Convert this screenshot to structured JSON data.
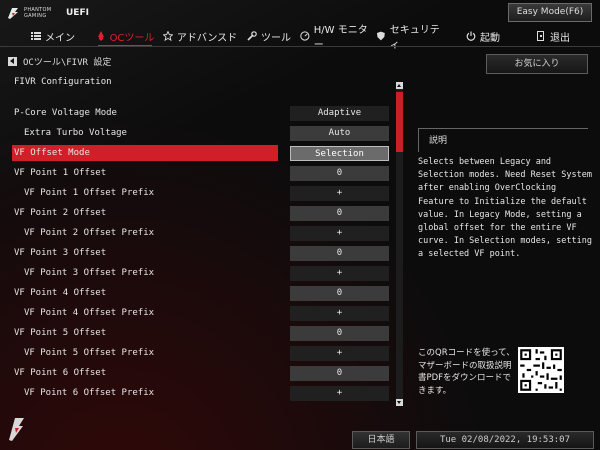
{
  "header": {
    "brand_line1": "PHANTOM",
    "brand_line2": "GAMING",
    "brand_uefi": "UEFI",
    "easy_mode": "Easy Mode(F6)"
  },
  "nav": [
    {
      "label": "メイン",
      "icon": "list-icon"
    },
    {
      "label": "OCツール",
      "icon": "rocket-icon",
      "active": true
    },
    {
      "label": "アドバンスド",
      "icon": "star-icon"
    },
    {
      "label": "ツール",
      "icon": "wrench-icon"
    },
    {
      "label": "H/W モニター",
      "icon": "monitor-icon"
    },
    {
      "label": "セキュリティ",
      "icon": "shield-icon"
    },
    {
      "label": "起動",
      "icon": "power-icon"
    },
    {
      "label": "退出",
      "icon": "exit-icon"
    }
  ],
  "breadcrumb": "OCツール\\FIVR 設定",
  "section_title": "FIVR Configuration",
  "favorite": "お気に入り",
  "rows": [
    {
      "label": "P-Core Voltage Mode",
      "indent": 0,
      "value": "Adaptive",
      "style": "dark"
    },
    {
      "label": "Extra Turbo Voltage",
      "indent": 1,
      "value": "Auto",
      "style": "light"
    },
    {
      "label": "VF Offset Mode",
      "indent": 0,
      "value": "Selection",
      "style": "sel",
      "highlight": true
    },
    {
      "label": "VF Point 1 Offset",
      "indent": 0,
      "value": "0",
      "style": "light"
    },
    {
      "label": "VF Point 1 Offset Prefix",
      "indent": 2,
      "value": "+",
      "style": "dark"
    },
    {
      "label": "VF Point 2 Offset",
      "indent": 0,
      "value": "0",
      "style": "light"
    },
    {
      "label": "VF Point 2 Offset Prefix",
      "indent": 2,
      "value": "+",
      "style": "dark"
    },
    {
      "label": "VF Point 3 Offset",
      "indent": 0,
      "value": "0",
      "style": "light"
    },
    {
      "label": "VF Point 3 Offset Prefix",
      "indent": 2,
      "value": "+",
      "style": "dark"
    },
    {
      "label": "VF Point 4 Offset",
      "indent": 0,
      "value": "0",
      "style": "light"
    },
    {
      "label": "VF Point 4 Offset Prefix",
      "indent": 2,
      "value": "+",
      "style": "dark"
    },
    {
      "label": "VF Point 5 Offset",
      "indent": 0,
      "value": "0",
      "style": "light"
    },
    {
      "label": "VF Point 5 Offset Prefix",
      "indent": 2,
      "value": "+",
      "style": "dark"
    },
    {
      "label": "VF Point 6 Offset",
      "indent": 0,
      "value": "0",
      "style": "light"
    },
    {
      "label": "VF Point 6 Offset Prefix",
      "indent": 2,
      "value": "+",
      "style": "dark"
    }
  ],
  "help": {
    "title": "説明",
    "text": "Selects between Legacy and Selection modes. Need Reset System after enabling OverClocking Feature to Initialize the default value. In Legacy Mode, setting a global offset for the entire VF curve. In Selection modes, setting a selected VF point."
  },
  "qr_text": "このQRコードを使って、マザーボードの取扱説明書PDFをダウンロードできます。",
  "footer": {
    "language": "日本語",
    "datetime": "Tue 02/08/2022, 19:53:07"
  },
  "colors": {
    "accent": "#d11f29",
    "background": "#0c0c0d"
  }
}
